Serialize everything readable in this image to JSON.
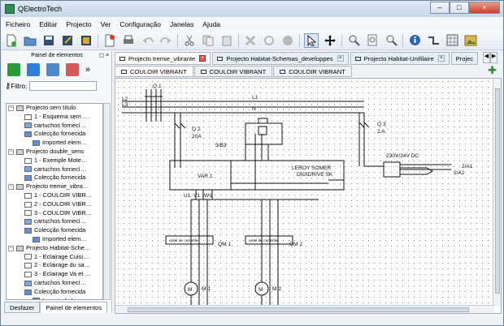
{
  "window": {
    "title": "QElectroTech",
    "controls": {
      "minimize": "–",
      "maximize": "□",
      "close": "×"
    }
  },
  "menubar": [
    "Ficheiro",
    "Editar",
    "Projecto",
    "Ver",
    "Configuração",
    "Janelas",
    "Ajuda"
  ],
  "toolbar": {
    "buttons": [
      "new-icon",
      "open-icon",
      "save-icon",
      "save-as-icon",
      "save-all-icon",
      "close-icon",
      "print-icon",
      "undo-icon",
      "redo-icon",
      "cut-icon",
      "copy-icon",
      "paste-icon",
      "delete-icon",
      "rotate-icon",
      "info-icon",
      "select-icon",
      "move-icon",
      "zoom-in-icon",
      "zoom-fit-icon",
      "zoom-out-icon",
      "about-icon",
      "conductor-icon",
      "grid-icon",
      "image-icon"
    ],
    "selected": "select-icon"
  },
  "dock": {
    "title": "Painel de elementos",
    "filter_label": "Filtro:",
    "filter_value": "",
    "tree": [
      {
        "label": "Projecto sem título",
        "level": 0,
        "type": "project"
      },
      {
        "label": "1 - Esquema sem …",
        "level": 1,
        "type": "folio"
      },
      {
        "label": "cartuchos fornecí…",
        "level": 1,
        "type": "cartridge"
      },
      {
        "label": "Colecção fornecida",
        "level": 1,
        "type": "collection"
      },
      {
        "label": "Imported elem…",
        "level": 2,
        "type": "collection"
      },
      {
        "label": "Projecto double_sens",
        "level": 0,
        "type": "project"
      },
      {
        "label": "1 - Exemple Mote…",
        "level": 1,
        "type": "folio"
      },
      {
        "label": "cartuchos fornecí…",
        "level": 1,
        "type": "cartridge"
      },
      {
        "label": "Colecção fornecida",
        "level": 1,
        "type": "collection"
      },
      {
        "label": "Projecto tremie_vibra…",
        "level": 0,
        "type": "project"
      },
      {
        "label": "1 - COULOIR VIBR…",
        "level": 1,
        "type": "folio"
      },
      {
        "label": "2 - COULOIR VIBR…",
        "level": 1,
        "type": "folio"
      },
      {
        "label": "3 - COULOIR VIBR…",
        "level": 1,
        "type": "folio"
      },
      {
        "label": "cartuchos fornecí…",
        "level": 1,
        "type": "cartridge"
      },
      {
        "label": "Colecção fornecida",
        "level": 1,
        "type": "collection"
      },
      {
        "label": "Imported elem…",
        "level": 2,
        "type": "collection"
      },
      {
        "label": "Projecto Habitat-Sche…",
        "level": 0,
        "type": "project"
      },
      {
        "label": "1 - Eclairage Cuisi…",
        "level": 1,
        "type": "folio"
      },
      {
        "label": "2 - Eclairage du sa…",
        "level": 1,
        "type": "folio"
      },
      {
        "label": "3 - Eclairage Va et …",
        "level": 1,
        "type": "folio"
      },
      {
        "label": "cartuchos fornecí…",
        "level": 1,
        "type": "cartridge"
      },
      {
        "label": "Colecção fornecida",
        "level": 1,
        "type": "collection"
      },
      {
        "label": "Imported elem…",
        "level": 2,
        "type": "collection"
      }
    ],
    "bottom_tabs": [
      "Desfazer",
      "Painel de elementos"
    ],
    "active_bottom_tab": "Painel de elementos"
  },
  "document_tabs": [
    {
      "label": "Projecto tremie_vibrante",
      "active": true
    },
    {
      "label": "Projecto Habitat-Schemas_developpes",
      "active": false
    },
    {
      "label": "Projecto Habitat-Unifilaire",
      "active": false
    },
    {
      "label": "Projec",
      "active": false
    }
  ],
  "folio_tabs": [
    {
      "label": "COULOIR VIBRANT",
      "active": true
    },
    {
      "label": "COULOIR VIBRANT",
      "active": false
    },
    {
      "label": "COULOIR VIBRANT",
      "active": false
    }
  ],
  "schematic": {
    "labels": {
      "q1": "Q 1",
      "q2": "Q 2",
      "q2_rating": "20A",
      "q3": "Q 3",
      "q3_rating": "2 A",
      "ref_3b3": "3/B3",
      "var1": "VAR 1",
      "manufacturer": "LEROY SOMER",
      "model": "DIGIDRIVE SK",
      "psu": "230V/24V DC",
      "out1": "2/A1",
      "out2": "2/A1",
      "qm1": "QM 1",
      "qm2": "QM 2",
      "m1": "M 1",
      "m2": "M 2",
      "motor_symbol": "M",
      "control_unit": "unité de contrôle",
      "l1": "L1",
      "l2": "L2",
      "l3": "L3",
      "n": "N",
      "v1": "V1",
      "w1": "W1",
      "u1": "U1"
    }
  },
  "colors": {
    "accent": "#2e8b57",
    "close_tab": "#d85a4b",
    "selected_toolbar": "#d9e6f5"
  }
}
